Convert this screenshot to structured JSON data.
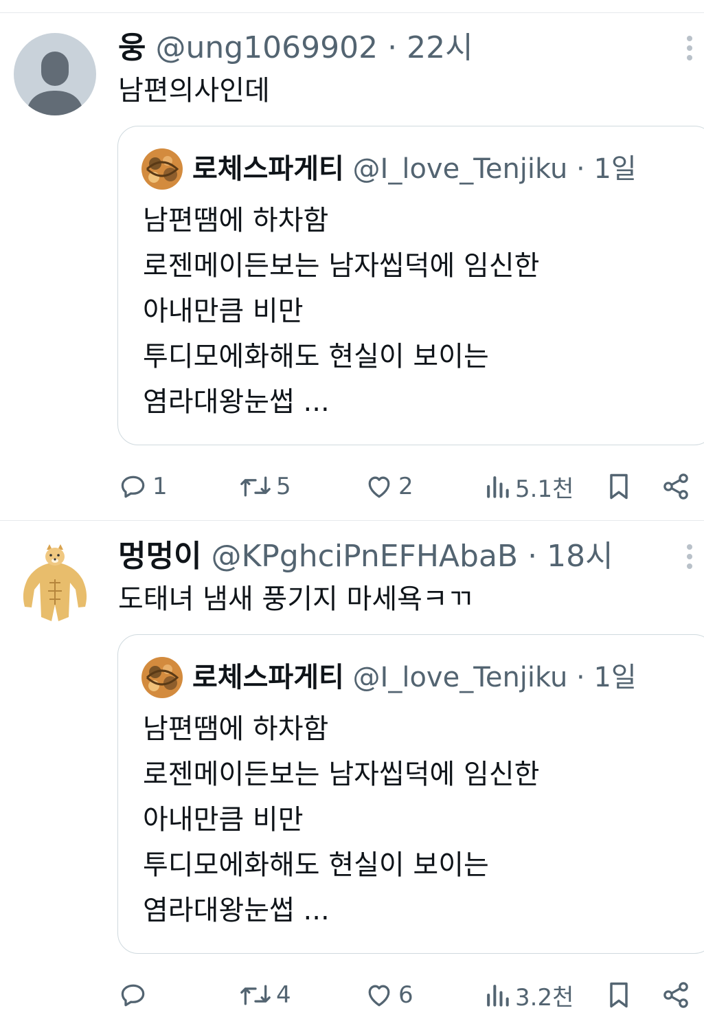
{
  "posts": [
    {
      "author_name": "웅",
      "handle": "@ung1069902",
      "dot": "·",
      "time": "22시",
      "text": "남편의사인데",
      "quote": {
        "author_name": "로체스파게티",
        "handle": "@I_love_Tenjiku",
        "dot": "·",
        "time": "1일",
        "lines": [
          "남편땜에 하차함",
          "로젠메이든보는 남자씹덕에 임신한",
          "아내만큼 비만",
          "투디모에화해도 현실이 보이는",
          "염라대왕눈썹 ..."
        ]
      },
      "stats": {
        "replies": "1",
        "reposts": "5",
        "likes": "2",
        "views": "5.1천"
      }
    },
    {
      "author_name": "멍멍이",
      "handle": "@KPghciPnEFHAbaB",
      "dot": "·",
      "time": "18시",
      "text": "도태녀 냄새 풍기지 마세욕ㅋㄲ",
      "quote": {
        "author_name": "로체스파게티",
        "handle": "@I_love_Tenjiku",
        "dot": "·",
        "time": "1일",
        "lines": [
          "남편땜에 하차함",
          "로젠메이든보는 남자씹덕에 임신한",
          "아내만큼 비만",
          "투디모에화해도 현실이 보이는",
          "염라대왕눈썹 ..."
        ]
      },
      "stats": {
        "replies": "",
        "reposts": "4",
        "likes": "6",
        "views": "3.2천"
      }
    }
  ],
  "icons": {
    "reply": "reply-icon",
    "repost": "repost-icon",
    "like": "heart-icon",
    "views": "views-icon",
    "bookmark": "bookmark-icon",
    "share": "share-icon",
    "more": "more-vertical-icon"
  },
  "colors": {
    "muted": "#536471",
    "text": "#0f1419",
    "border": "#cfd9de"
  }
}
